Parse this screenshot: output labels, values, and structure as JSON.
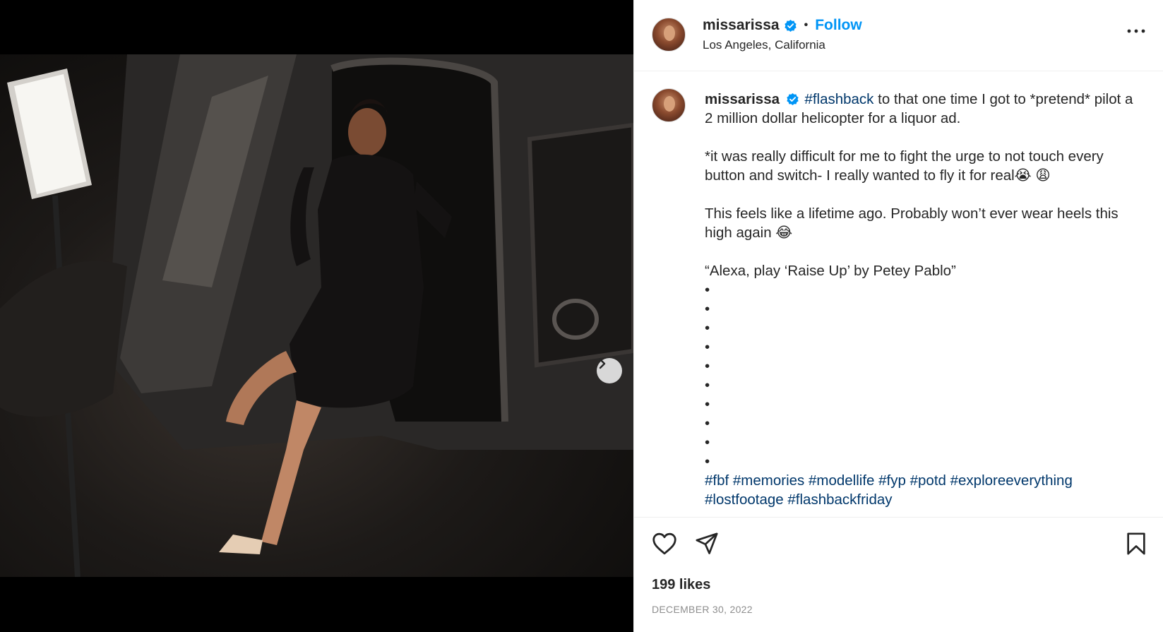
{
  "post": {
    "username": "missarissa",
    "follow_label": "Follow",
    "separator": "•",
    "location": "Los Angeles, California",
    "carousel": {
      "total": 4,
      "current": 1
    },
    "colors": {
      "accent": "#0095f6",
      "hashtag": "#00376b",
      "verified": "#0095f6"
    }
  },
  "caption": {
    "username": "missarissa",
    "lead_tag": "#flashback",
    "line1": " to that one time I got to *pretend* pilot a 2 million dollar helicopter for a liquor ad.",
    "para2": "*it was really difficult for me to fight the urge to not touch every button and switch- I really wanted to fly it for real😭 😩",
    "para3": "This feels like a lifetime ago. Probably won’t ever wear heels this high again 😂",
    "para4": "“Alexa, play ‘Raise Up’ by Petey Pablo”",
    "bullets": [
      "•",
      "•",
      "•",
      "•",
      "•",
      "•",
      "•",
      "•",
      "•",
      "•"
    ],
    "hashtags": [
      "#fbf",
      "#memories",
      "#modellife",
      "#fyp",
      "#potd",
      "#exploreeverything",
      "#lostfootage",
      "#flashbackfriday"
    ]
  },
  "footer": {
    "likes": "199 likes",
    "date": "DECEMBER 30, 2022"
  },
  "icons": {
    "verified": "verified-badge-icon",
    "more": "more-options-icon",
    "next": "chevron-right-icon",
    "like": "heart-icon",
    "share": "paper-plane-icon",
    "save": "bookmark-icon"
  }
}
